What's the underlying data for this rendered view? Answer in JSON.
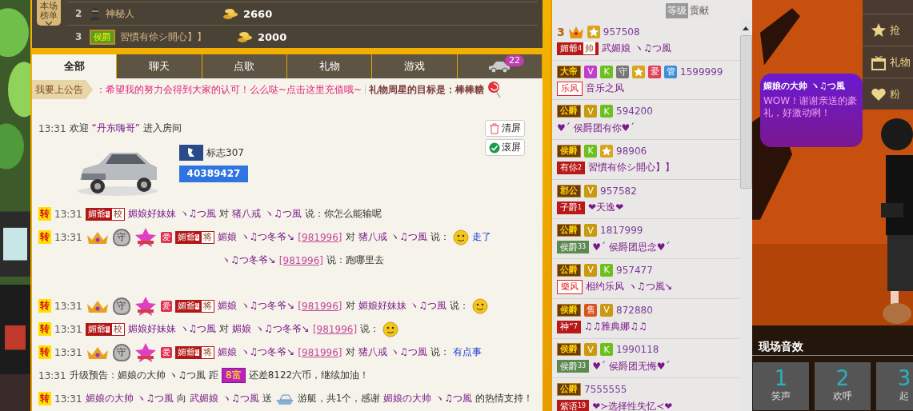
{
  "rank_board": {
    "toggle": "本场榜单",
    "rows": [
      {
        "rank": "2",
        "kind": "mystery",
        "name": "神秘人",
        "score": "2660"
      },
      {
        "rank": "3",
        "kind": "noble",
        "badge": "侯爵",
        "name": "習慣有伱シ開心】】",
        "score": "2000"
      }
    ]
  },
  "tabs": [
    {
      "kind": "text",
      "label": "全部",
      "selected": true
    },
    {
      "kind": "text",
      "label": "聊天",
      "selected": false
    },
    {
      "kind": "text",
      "label": "点歌",
      "selected": false
    },
    {
      "kind": "text",
      "label": "礼物",
      "selected": false
    },
    {
      "kind": "text",
      "label": "游戏",
      "selected": false
    },
    {
      "kind": "car",
      "count": "22",
      "selected": false
    }
  ],
  "announcement": {
    "button": "我要上公告",
    "message": "：希望我的努力会得到大家的认可！么么哒~点击这里充值哦~",
    "goal": "礼物周星的目标是：棒棒糖"
  },
  "chat_tools": [
    {
      "kind": "clear",
      "label": "清屏"
    },
    {
      "kind": "scroll",
      "label": "滚屏",
      "checked": true
    }
  ],
  "welcome": {
    "time": "13:31",
    "before": "欢迎",
    "name": "“丹东嗨哥”",
    "after": "进入房间",
    "car": {
      "model": "标志307",
      "number": "40389427"
    }
  },
  "messages": [
    {
      "forward": "转",
      "time": "13:31",
      "covered": false,
      "parts": [
        {
          "kind": "rank",
          "text": "媚爺",
          "tier": "4",
          "title": "校"
        },
        {
          "kind": "user",
          "text": "媚娘好妹妹 ヽ♫つ風"
        },
        {
          "kind": "text",
          "text": "对"
        },
        {
          "kind": "user",
          "text": "猪八戒 ヽ♫つ風"
        },
        {
          "kind": "text",
          "text": "说：你怎么能输呢"
        }
      ]
    },
    {
      "forward": "转",
      "time": "13:31",
      "covered": false,
      "parts": [
        {
          "kind": "crown"
        },
        {
          "kind": "guard",
          "text": "守"
        },
        {
          "kind": "star"
        },
        {
          "kind": "love",
          "text": "爱"
        },
        {
          "kind": "rank",
          "text": "媚爺",
          "tier": "4",
          "title": "将"
        },
        {
          "kind": "user",
          "text": "媚娘 ヽ♫つ冬爷↘"
        },
        {
          "kind": "id",
          "text": "[981996]"
        },
        {
          "kind": "text",
          "text": "对"
        },
        {
          "kind": "user",
          "text": "猪八戒 ヽ♫つ風"
        },
        {
          "kind": "text",
          "text": "说："
        },
        {
          "kind": "emoji"
        },
        {
          "kind": "quote",
          "text": "走了"
        }
      ]
    },
    {
      "covered": true,
      "parts": [
        {
          "kind": "user",
          "text": "ヽ♫つ冬爷↘"
        },
        {
          "kind": "id",
          "text": "[981996]"
        },
        {
          "kind": "text",
          "text": "说：跑哪里去"
        }
      ]
    },
    {
      "forward": "转",
      "time": "13:31",
      "covered": false,
      "parts": [
        {
          "kind": "crown"
        },
        {
          "kind": "guard",
          "text": "守"
        },
        {
          "kind": "star"
        },
        {
          "kind": "love",
          "text": "爱"
        },
        {
          "kind": "rank",
          "text": "媚爺",
          "tier": "4",
          "title": "将"
        },
        {
          "kind": "user",
          "text": "媚娘 ヽ♫つ冬爷↘"
        },
        {
          "kind": "id",
          "text": "[981996]"
        },
        {
          "kind": "text",
          "text": "对"
        },
        {
          "kind": "user",
          "text": "媚娘好妹妹 ヽ♫つ風"
        },
        {
          "kind": "text",
          "text": "说："
        },
        {
          "kind": "emoji"
        }
      ]
    },
    {
      "forward": "转",
      "time": "13:31",
      "covered": false,
      "parts": [
        {
          "kind": "rank",
          "text": "媚爺",
          "tier": "4",
          "title": "校"
        },
        {
          "kind": "user",
          "text": "媚娘好妹妹 ヽ♫つ風"
        },
        {
          "kind": "text",
          "text": "对"
        },
        {
          "kind": "user",
          "text": "媚娘 ヽ♫つ冬爷↘"
        },
        {
          "kind": "id",
          "text": "[981996]"
        },
        {
          "kind": "text",
          "text": "说："
        },
        {
          "kind": "emoji"
        }
      ]
    },
    {
      "forward": "转",
      "time": "13:31",
      "covered": false,
      "parts": [
        {
          "kind": "crown"
        },
        {
          "kind": "guard",
          "text": "守"
        },
        {
          "kind": "star"
        },
        {
          "kind": "love",
          "text": "爱"
        },
        {
          "kind": "rank",
          "text": "媚爺",
          "tier": "4",
          "title": "将"
        },
        {
          "kind": "user",
          "text": "媚娘 ヽ♫つ冬爷↘"
        },
        {
          "kind": "id",
          "text": "[981996]"
        },
        {
          "kind": "text",
          "text": "对"
        },
        {
          "kind": "user",
          "text": "猪八戒 ヽ♫つ風"
        },
        {
          "kind": "text",
          "text": "说："
        },
        {
          "kind": "quote",
          "text": "有点事"
        }
      ]
    },
    {
      "time": "13:31",
      "covered": false,
      "parts": [
        {
          "kind": "text",
          "text": "升级预告：媚娘の大帅 ヽ♫つ風 距"
        },
        {
          "kind": "level",
          "text": "8富"
        },
        {
          "kind": "text",
          "text": "还差8122六币，继续加油！"
        }
      ]
    },
    {
      "forward": "转",
      "time": "13:31",
      "covered": false,
      "parts": [
        {
          "kind": "user",
          "text": "媚娘の大帅 ヽ♫つ風"
        },
        {
          "kind": "text",
          "text": "向"
        },
        {
          "kind": "user",
          "text": "武媚娘 ヽ♫つ風"
        },
        {
          "kind": "text",
          "text": "送"
        },
        {
          "kind": "gift"
        },
        {
          "kind": "text",
          "text": "游艇，共1个，感谢"
        },
        {
          "kind": "user",
          "text": "媚娘の大帅 ヽ♫つ風"
        },
        {
          "kind": "text",
          "text": "的热情支持！"
        }
      ]
    }
  ],
  "ranking_list": {
    "sort_tabs": [
      {
        "label": "等级",
        "selected": true
      },
      {
        "label": "贡献",
        "selected": false
      }
    ],
    "entries": [
      {
        "badges": [
          {
            "kind": "number",
            "text": "3"
          },
          {
            "kind": "crown"
          },
          {
            "kind": "star"
          }
        ],
        "number": "957508",
        "title": {
          "kind": "red",
          "text": "媚爺",
          "tier": "4",
          "extra": "帅"
        },
        "name": "武媚娘 ヽ♫つ風"
      },
      {
        "badges": [
          {
            "kind": "noble",
            "text": "大帝"
          },
          {
            "kind": "square",
            "text": "V",
            "color": "#c23fc9"
          },
          {
            "kind": "square",
            "text": "K",
            "color": "#6cbf1f"
          },
          {
            "kind": "square",
            "text": "守",
            "color": "#777777"
          },
          {
            "kind": "star"
          },
          {
            "kind": "square",
            "text": "爱",
            "color": "#e0405a"
          },
          {
            "kind": "square",
            "text": "管",
            "color": "#3f8fd8"
          }
        ],
        "number": "1599999",
        "title": {
          "kind": "outline",
          "text": "乐风"
        },
        "name": "音乐之风"
      },
      {
        "badges": [
          {
            "kind": "noble",
            "text": "公爵"
          },
          {
            "kind": "square",
            "text": "V",
            "color": "#c99a10"
          },
          {
            "kind": "square",
            "text": "K",
            "color": "#6cbf1f"
          }
        ],
        "number": "594200",
        "name": "♥ˊ 侯爵团有你♥ˊ"
      },
      {
        "badges": [
          {
            "kind": "noble",
            "text": "侯爵"
          },
          {
            "kind": "square",
            "text": "K",
            "color": "#6cbf1f"
          },
          {
            "kind": "star"
          }
        ],
        "number": "98906",
        "title": {
          "kind": "red",
          "text": "有伱",
          "tier": "2"
        },
        "name": "習慣有伱シ開心】】"
      },
      {
        "badges": [
          {
            "kind": "noble",
            "text": "郡公"
          },
          {
            "kind": "square",
            "text": "V",
            "color": "#c99a10"
          }
        ],
        "number": "957582",
        "title": {
          "kind": "red",
          "text": "子爵",
          "tier": "1"
        },
        "name": "❤天逸❤"
      },
      {
        "badges": [
          {
            "kind": "noble",
            "text": "公爵"
          },
          {
            "kind": "square",
            "text": "V",
            "color": "#c99a10"
          }
        ],
        "number": "1817999",
        "title": {
          "kind": "green",
          "text": "侯爵",
          "tier": "33"
        },
        "name": "♥ˊ 侯爵团思念♥ˊ"
      },
      {
        "badges": [
          {
            "kind": "noble",
            "text": "公爵"
          },
          {
            "kind": "square",
            "text": "V",
            "color": "#c99a10"
          },
          {
            "kind": "square",
            "text": "K",
            "color": "#6cbf1f"
          }
        ],
        "number": "957477",
        "title": {
          "kind": "outline",
          "text": "樂风"
        },
        "name": "相约乐风 ヽ♫つ風↘"
      },
      {
        "badges": [
          {
            "kind": "noble",
            "text": "侯爵"
          },
          {
            "kind": "square",
            "text": "售",
            "color": "#d9531e"
          },
          {
            "kind": "square",
            "text": "V",
            "color": "#c99a10"
          }
        ],
        "number": "872880",
        "title": {
          "kind": "red",
          "text": "神“",
          "tier": "7"
        },
        "name": "♫♫雅典娜♫♫"
      },
      {
        "badges": [
          {
            "kind": "noble",
            "text": "侯爵"
          },
          {
            "kind": "square",
            "text": "V",
            "color": "#c99a10"
          },
          {
            "kind": "square",
            "text": "K",
            "color": "#6cbf1f"
          }
        ],
        "number": "1990118",
        "title": {
          "kind": "green",
          "text": "侯爵",
          "tier": "33"
        },
        "name": "♥ˊ 侯爵团无悔♥ˊ"
      },
      {
        "badges": [
          {
            "kind": "noble",
            "text": "公爵"
          }
        ],
        "number": "7555555",
        "title": {
          "kind": "red",
          "text": "紫语",
          "tier": "19"
        },
        "name": "❤≻选择性失忆≺❤"
      }
    ]
  },
  "speech_bubble": {
    "name": "媚娘の大帅 ヽ♫つ風",
    "text": "WOW！谢谢亲送的豪礼，好激动咧！"
  },
  "side_menu": [
    {
      "kind": "star",
      "label": "抢"
    },
    {
      "kind": "gift",
      "label": "礼物"
    },
    {
      "kind": "heart",
      "label": "粉"
    }
  ],
  "sound_effects": {
    "title": "现场音效",
    "buttons": [
      {
        "number": "1",
        "label": "笑声"
      },
      {
        "number": "2",
        "label": "欢呼"
      },
      {
        "number": "3",
        "label": "起"
      }
    ]
  }
}
